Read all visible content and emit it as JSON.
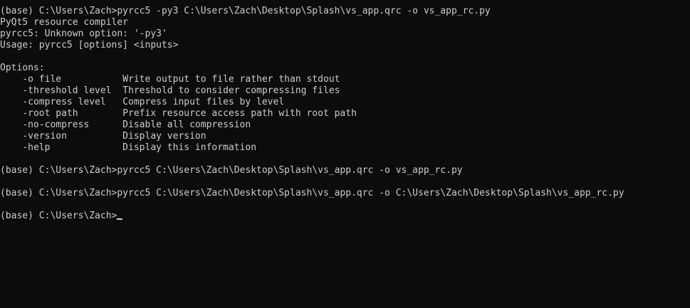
{
  "console": {
    "background_color": "#0c0c0c",
    "text_color": "#cccccc",
    "lines": [
      "(base) C:\\Users\\Zach>pyrcc5 -py3 C:\\Users\\Zach\\Desktop\\Splash\\vs_app.qrc -o vs_app_rc.py",
      "PyQt5 resource compiler",
      "pyrcc5: Unknown option: '-py3'",
      "Usage: pyrcc5 [options] <inputs>",
      "",
      "Options:",
      "    -o file           Write output to file rather than stdout",
      "    -threshold level  Threshold to consider compressing files",
      "    -compress level   Compress input files by level",
      "    -root path        Prefix resource access path with root path",
      "    -no-compress      Disable all compression",
      "    -version          Display version",
      "    -help             Display this information",
      "",
      "(base) C:\\Users\\Zach>pyrcc5 C:\\Users\\Zach\\Desktop\\Splash\\vs_app.qrc -o vs_app_rc.py",
      "",
      "(base) C:\\Users\\Zach>pyrcc5 C:\\Users\\Zach\\Desktop\\Splash\\vs_app.qrc -o C:\\Users\\Zach\\Desktop\\Splash\\vs_app_rc.py",
      "",
      "(base) C:\\Users\\Zach>"
    ]
  }
}
